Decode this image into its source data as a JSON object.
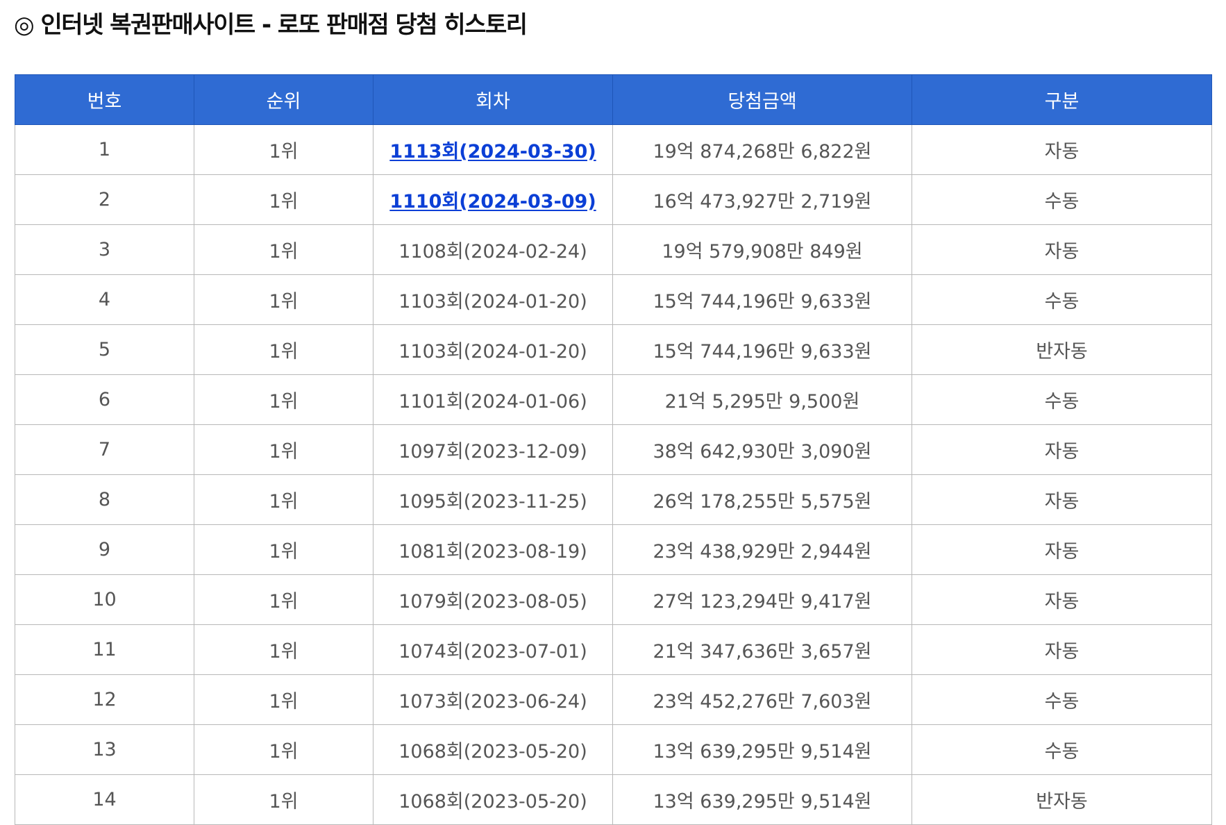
{
  "title": "◎ 인터넷 복권판매사이트 - 로또 판매점 당첨 히스토리",
  "table": {
    "headers": [
      "번호",
      "순위",
      "회차",
      "당첨금액",
      "구분"
    ],
    "rows": [
      {
        "no": "1",
        "rank": "1위",
        "draw": "1113회(2024-03-30)",
        "amount": "19억 874,268만 6,822원",
        "type": "자동",
        "link": true
      },
      {
        "no": "2",
        "rank": "1위",
        "draw": "1110회(2024-03-09)",
        "amount": "16억 473,927만 2,719원",
        "type": "수동",
        "link": true
      },
      {
        "no": "3",
        "rank": "1위",
        "draw": "1108회(2024-02-24)",
        "amount": "19억 579,908만 849원",
        "type": "자동",
        "link": false
      },
      {
        "no": "4",
        "rank": "1위",
        "draw": "1103회(2024-01-20)",
        "amount": "15억 744,196만 9,633원",
        "type": "수동",
        "link": false
      },
      {
        "no": "5",
        "rank": "1위",
        "draw": "1103회(2024-01-20)",
        "amount": "15억 744,196만 9,633원",
        "type": "반자동",
        "link": false
      },
      {
        "no": "6",
        "rank": "1위",
        "draw": "1101회(2024-01-06)",
        "amount": "21억 5,295만 9,500원",
        "type": "수동",
        "link": false
      },
      {
        "no": "7",
        "rank": "1위",
        "draw": "1097회(2023-12-09)",
        "amount": "38억 642,930만 3,090원",
        "type": "자동",
        "link": false
      },
      {
        "no": "8",
        "rank": "1위",
        "draw": "1095회(2023-11-25)",
        "amount": "26억 178,255만 5,575원",
        "type": "자동",
        "link": false
      },
      {
        "no": "9",
        "rank": "1위",
        "draw": "1081회(2023-08-19)",
        "amount": "23억 438,929만 2,944원",
        "type": "자동",
        "link": false
      },
      {
        "no": "10",
        "rank": "1위",
        "draw": "1079회(2023-08-05)",
        "amount": "27억 123,294만 9,417원",
        "type": "자동",
        "link": false
      },
      {
        "no": "11",
        "rank": "1위",
        "draw": "1074회(2023-07-01)",
        "amount": "21억 347,636만 3,657원",
        "type": "자동",
        "link": false
      },
      {
        "no": "12",
        "rank": "1위",
        "draw": "1073회(2023-06-24)",
        "amount": "23억 452,276만 7,603원",
        "type": "수동",
        "link": false
      },
      {
        "no": "13",
        "rank": "1위",
        "draw": "1068회(2023-05-20)",
        "amount": "13억 639,295만 9,514원",
        "type": "수동",
        "link": false
      },
      {
        "no": "14",
        "rank": "1위",
        "draw": "1068회(2023-05-20)",
        "amount": "13억 639,295만 9,514원",
        "type": "반자동",
        "link": false
      }
    ]
  }
}
